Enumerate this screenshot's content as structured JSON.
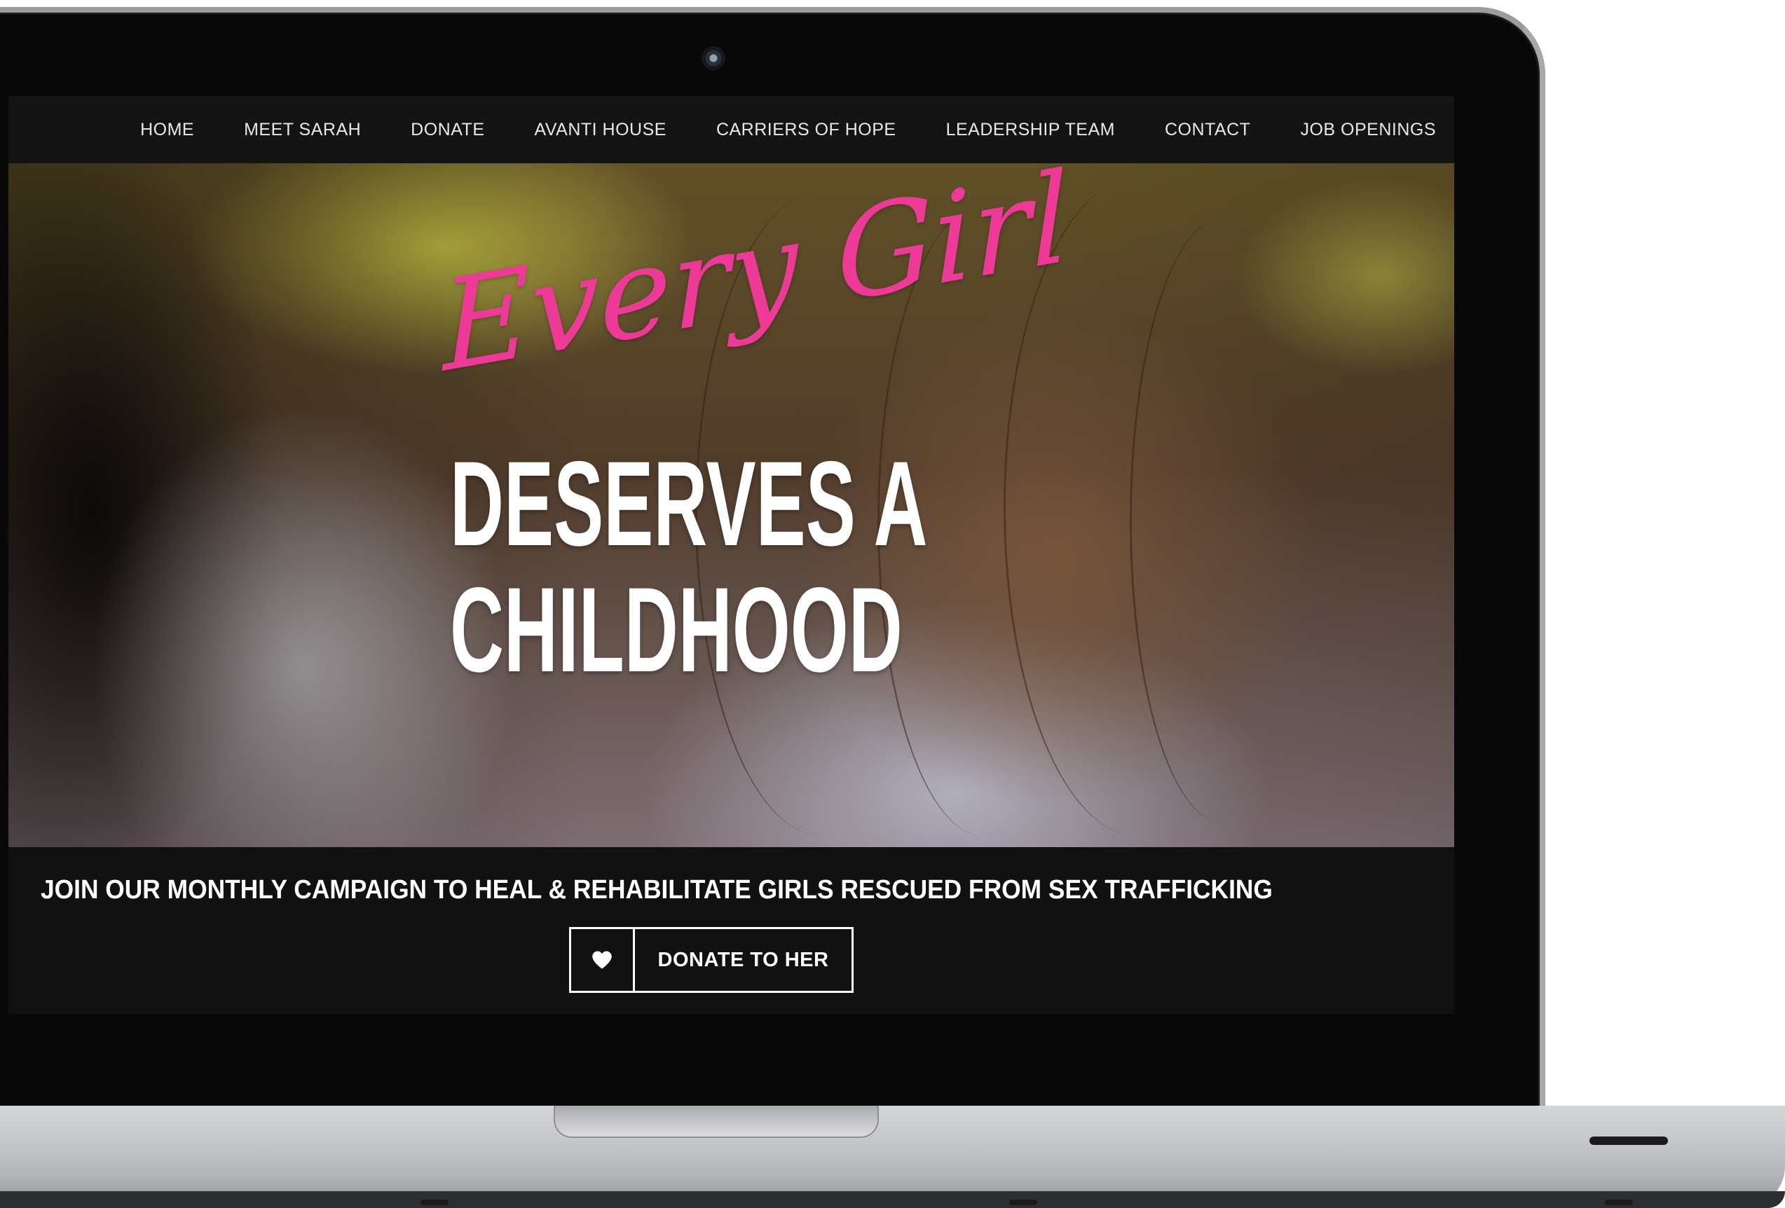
{
  "nav": {
    "items": [
      {
        "label": "HOME"
      },
      {
        "label": "MEET SARAH"
      },
      {
        "label": "DONATE"
      },
      {
        "label": "AVANTI HOUSE"
      },
      {
        "label": "CARRIERS OF HOPE"
      },
      {
        "label": "LEADERSHIP TEAM"
      },
      {
        "label": "CONTACT"
      },
      {
        "label": "JOB OPENINGS"
      }
    ]
  },
  "hero": {
    "script_text": "Every Girl",
    "headline_line1": "DESERVES A",
    "headline_line2": "CHILDHOOD"
  },
  "campaign": {
    "text": "JOIN OUR MONTHLY CAMPAIGN TO HEAL & REHABILITATE GIRLS RESCUED FROM SEX TRAFFICKING",
    "button_label": "DONATE TO HER",
    "button_icon": "heart-icon"
  },
  "colors": {
    "accent_pink": "#ee3a97",
    "nav_bg": "#141414",
    "panel_bg": "#111111",
    "text_white": "#ffffff"
  }
}
